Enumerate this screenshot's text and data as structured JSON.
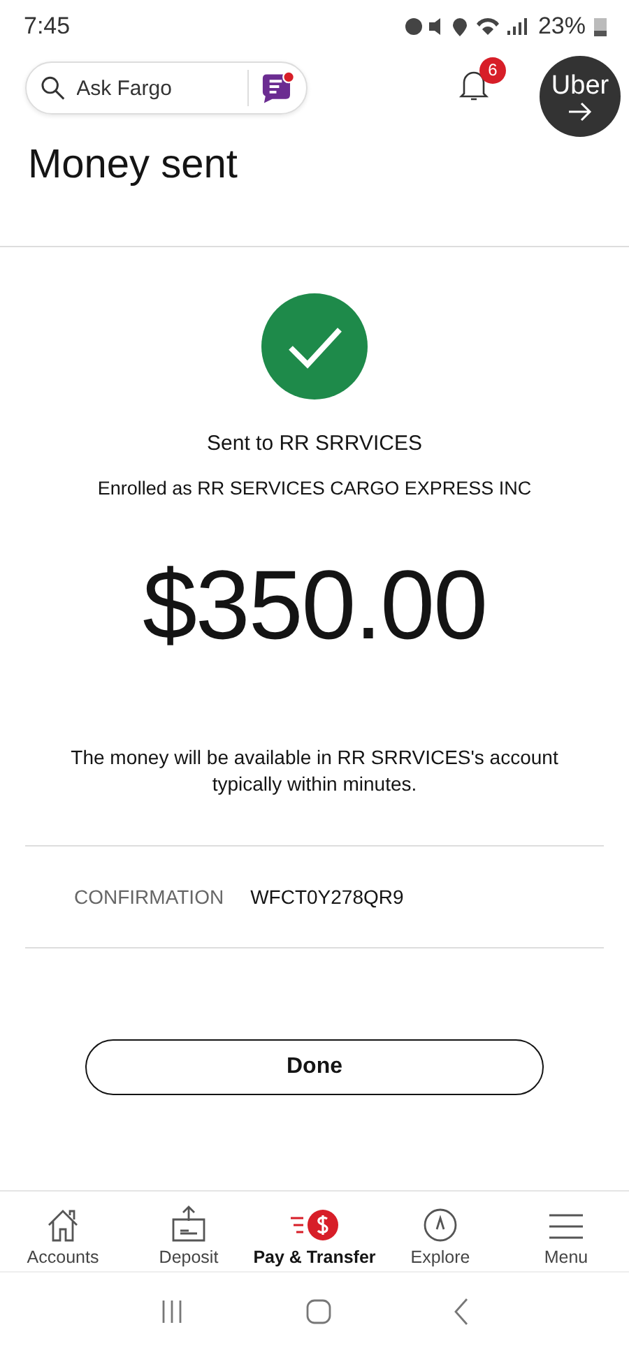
{
  "status_bar": {
    "time": "7:45",
    "battery": "23%"
  },
  "header": {
    "search": {
      "placeholder": "Ask Fargo"
    },
    "notifications": {
      "count": "6"
    },
    "chat_bubble": {
      "label": "Uber"
    }
  },
  "title": "Money sent",
  "result": {
    "recipient": "Sent to RR SRRVICES",
    "enrolled": "Enrolled as RR SERVICES CARGO EXPRESS INC",
    "amount": "$350.00",
    "message": "The money will be available in RR SRRVICES's account typically within minutes."
  },
  "confirmation": {
    "label": "CONFIRMATION",
    "value": "WFCT0Y278QR9"
  },
  "done_button": "Done",
  "bottom_nav": [
    {
      "label": "Accounts",
      "kind": "home",
      "selected": false
    },
    {
      "label": "Deposit",
      "kind": "deposit",
      "selected": false
    },
    {
      "label": "Pay & Transfer",
      "kind": "pay",
      "selected": true
    },
    {
      "label": "Explore",
      "kind": "compass",
      "selected": false
    },
    {
      "label": "Menu",
      "kind": "menu",
      "selected": false
    }
  ]
}
